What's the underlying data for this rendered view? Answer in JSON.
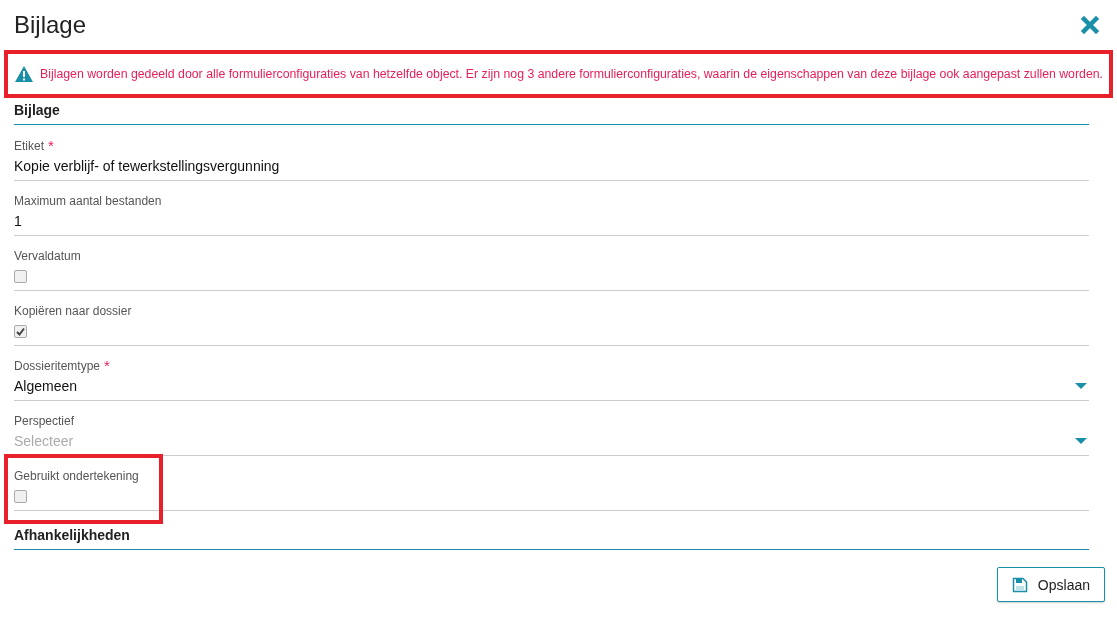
{
  "dialog": {
    "title": "Bijlage"
  },
  "alert": {
    "text": "Bijlagen worden gedeeld door alle formulierconfiguraties van hetzelfde object. Er zijn nog 3 andere formulierconfiguraties, waarin de eigenschappen van deze bijlage ook aangepast zullen worden.",
    "highlighted": true
  },
  "sections": [
    {
      "title": "Bijlage",
      "fields": [
        {
          "kind": "text",
          "label": "Etiket",
          "required_mark": "*",
          "value": "Kopie verblijf- of tewerkstellingsvergunning",
          "highlighted": false
        },
        {
          "kind": "text",
          "label": "Maximum aantal bestanden",
          "value": "1",
          "highlighted": false
        },
        {
          "kind": "checkbox",
          "label": "Vervaldatum",
          "checked": false,
          "highlighted": false
        },
        {
          "kind": "checkbox",
          "label": "Kopiëren naar dossier",
          "checked": true,
          "highlighted": false
        },
        {
          "kind": "select",
          "label": "Dossieritemtype",
          "required_mark": "*",
          "value": "Algemeen",
          "highlighted": false
        },
        {
          "kind": "select",
          "label": "Perspectief",
          "placeholder": "Selecteer",
          "highlighted": false
        },
        {
          "kind": "checkbox",
          "label": "Gebruikt ondertekening",
          "checked": false,
          "highlighted": true
        }
      ]
    },
    {
      "title": "Afhankelijkheden"
    }
  ],
  "buttons": [
    {
      "label": "Opslaan"
    }
  ]
}
